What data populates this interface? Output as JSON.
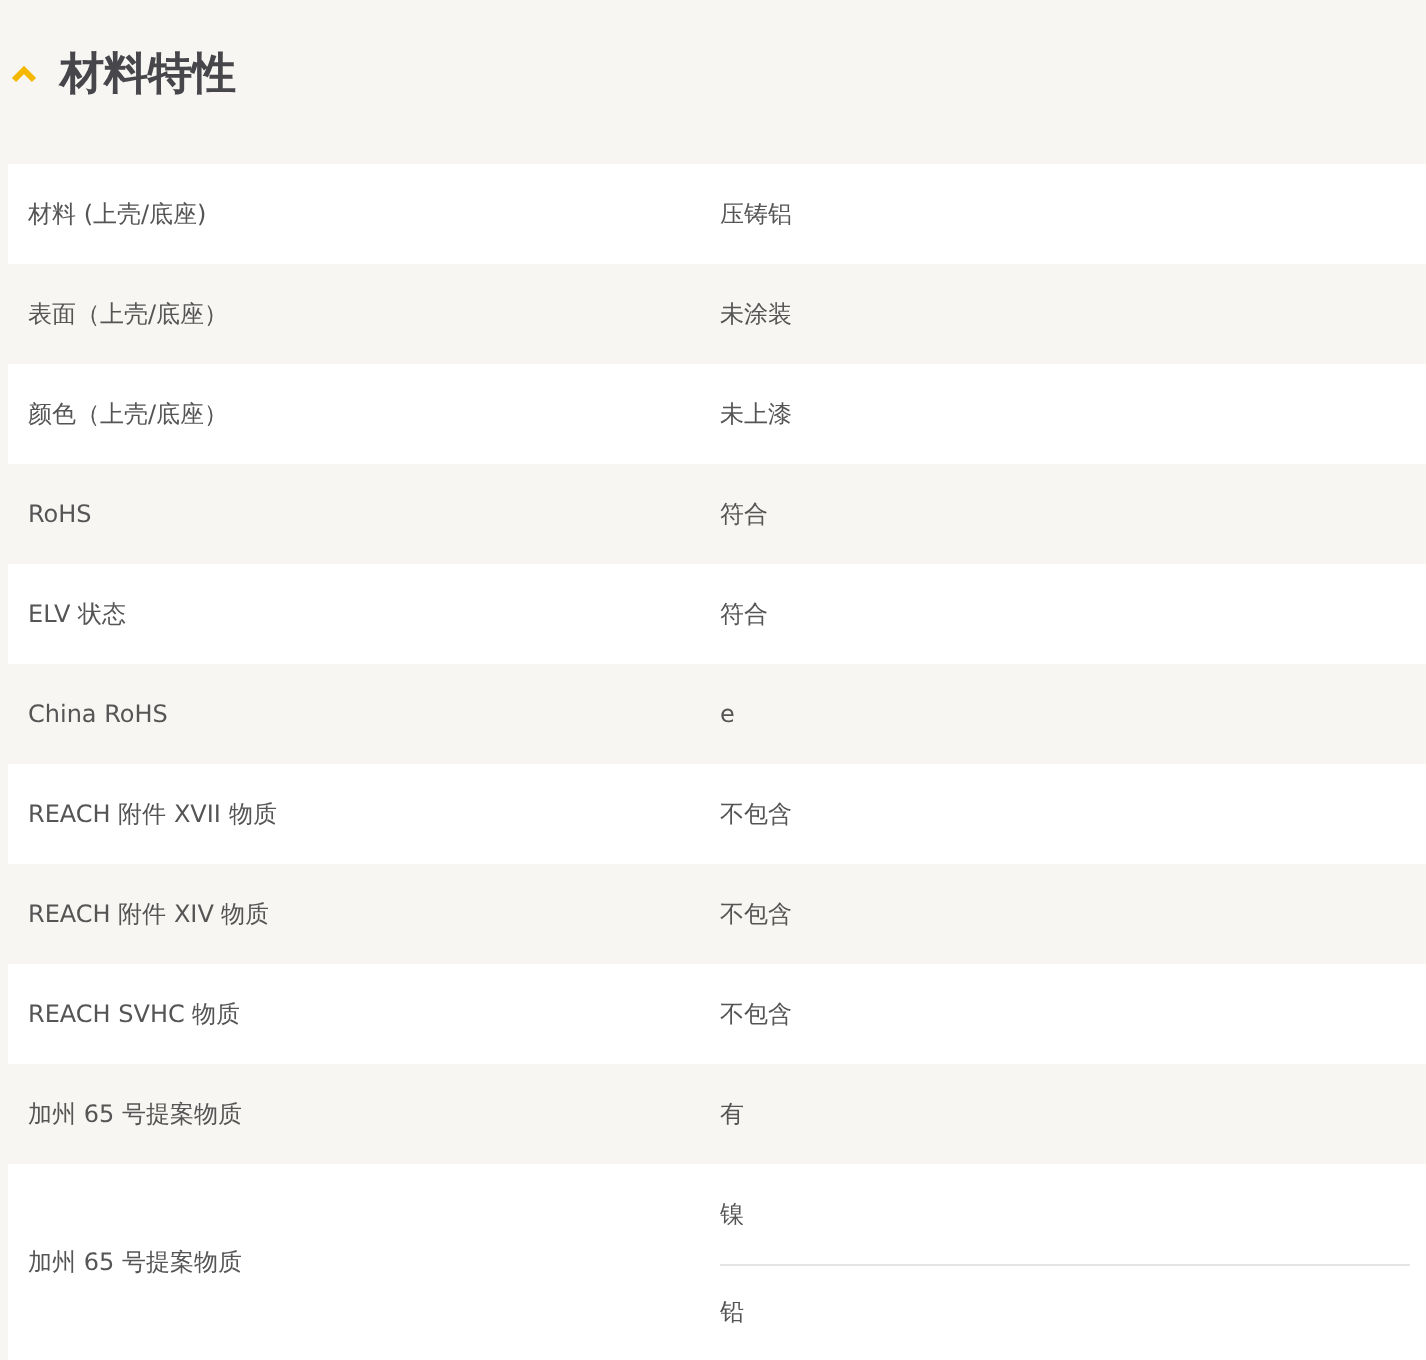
{
  "section": {
    "title": "材料特性",
    "expanded": true
  },
  "rows": [
    {
      "label": "材料 (上壳/底座)",
      "values": [
        "压铸铝"
      ]
    },
    {
      "label": "表面（上壳/底座）",
      "values": [
        "未涂装"
      ]
    },
    {
      "label": "颜色（上壳/底座）",
      "values": [
        "未上漆"
      ]
    },
    {
      "label": "RoHS",
      "values": [
        "符合"
      ]
    },
    {
      "label": "ELV 状态",
      "values": [
        "符合"
      ]
    },
    {
      "label": "China RoHS",
      "values": [
        "e"
      ]
    },
    {
      "label": "REACH 附件 XVII 物质",
      "values": [
        "不包含"
      ]
    },
    {
      "label": "REACH 附件 XIV 物质",
      "values": [
        "不包含"
      ]
    },
    {
      "label": "REACH SVHC 物质",
      "values": [
        "不包含"
      ]
    },
    {
      "label": "加州 65 号提案物质",
      "values": [
        "有"
      ]
    },
    {
      "label": "加州 65 号提案物质",
      "values": [
        "镍",
        "铅"
      ]
    }
  ]
}
